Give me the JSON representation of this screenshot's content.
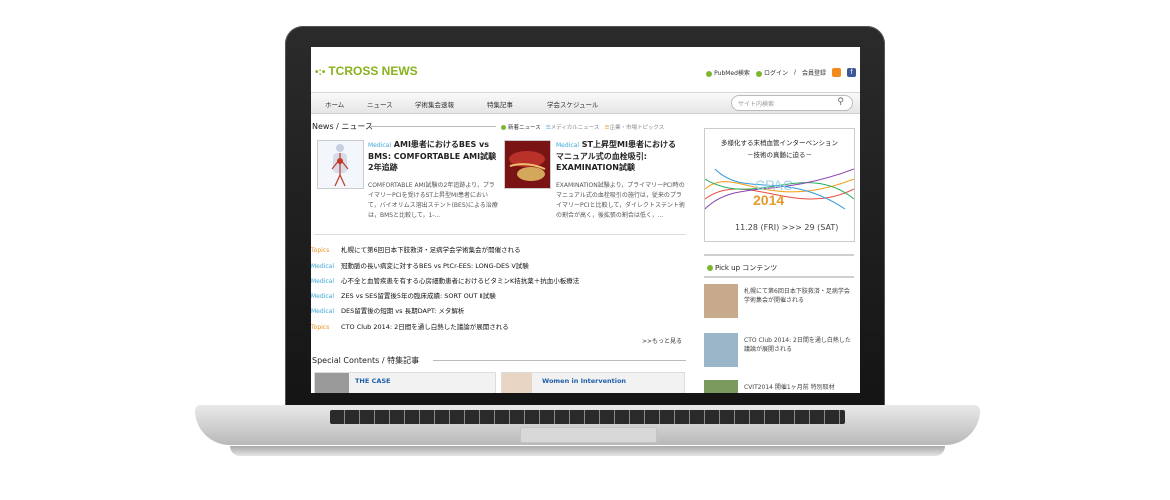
{
  "site": {
    "logo": "TCROSS NEWS",
    "top_links": [
      "PubMed検索",
      "ログイン",
      "/",
      "会員登録"
    ]
  },
  "nav": {
    "items": [
      "ホーム",
      "ニュース",
      "学術集会速報",
      "特集記事",
      "学会スケジュール"
    ],
    "search_placeholder": "サイト内検索"
  },
  "news": {
    "heading": "News / ニュース",
    "tabs": [
      "新着ニュース",
      "メディカルニュース",
      "企業・市場トピックス"
    ],
    "featured": [
      {
        "category": "Medical",
        "title": "AMI患者におけるBES vs BMS: COMFORTABLE AMI試験2年追跡",
        "text": "COMFORTABLE AMI試験の2年追跡より，プライマリーPCIを受けるST上昇型MI患者において，バイオリムス溶出ステント(BES)による治療は，BMSと比較して，1-..."
      },
      {
        "category": "Medical",
        "title": "ST上昇型MI患者におけるマニュアル式の血栓吸引: EXAMINATION試験",
        "text": "EXAMINATION試験より，プライマリーPCI時のマニュアル式の血栓吸引の施行は，従来のプライマリーPCIと比較して，ダイレクトステント術の割合が高く，後拡張の割合は低く，..."
      }
    ],
    "list": [
      {
        "category": "Topics",
        "title": "札幌にて第6回日本下肢救済・足病学会学術集会が開催される"
      },
      {
        "category": "Medical",
        "title": "冠動脈の長い病変に対するBES vs PtCr-EES: LONG-DES V試験"
      },
      {
        "category": "Medical",
        "title": "心不全と血管疾患を有する心房細動患者におけるビタミンK拮抗薬＋抗血小板療法"
      },
      {
        "category": "Medical",
        "title": "ZES vs SES留置後5年の臨床成績: SORT OUT Ⅱ試験"
      },
      {
        "category": "Medical",
        "title": "DES留置後の短期 vs 長期DAPT: メタ解析"
      },
      {
        "category": "Topics",
        "title": "CTO Club 2014: 2日間を通し白熱した議論が展開される"
      }
    ],
    "more": ">>もっと見る"
  },
  "special": {
    "heading": "Special Contents / 特集記事",
    "cards": [
      "THE CASE",
      "Women in Intervention"
    ]
  },
  "banner": {
    "line1": "多様化する末梢血管インターベンション",
    "line2": "－技術の真髄に迫る－",
    "brand1": "CPAC",
    "brand2": "2014",
    "dates": "11.28 (FRI) >>> 29 (SAT)"
  },
  "pickup": {
    "heading": "Pick up コンテンツ",
    "items": [
      "札幌にて第6回日本下肢救済・足病学会学術集会が開催される",
      "CTO Club 2014: 2日間を通し白熱した議論が展開される",
      "CVIT2014 開催1ヶ月前 特別取材"
    ]
  },
  "colors": {
    "brand_green": "#88b21e",
    "medical_blue": "#3fa7d8",
    "topics_orange": "#e8901c"
  }
}
